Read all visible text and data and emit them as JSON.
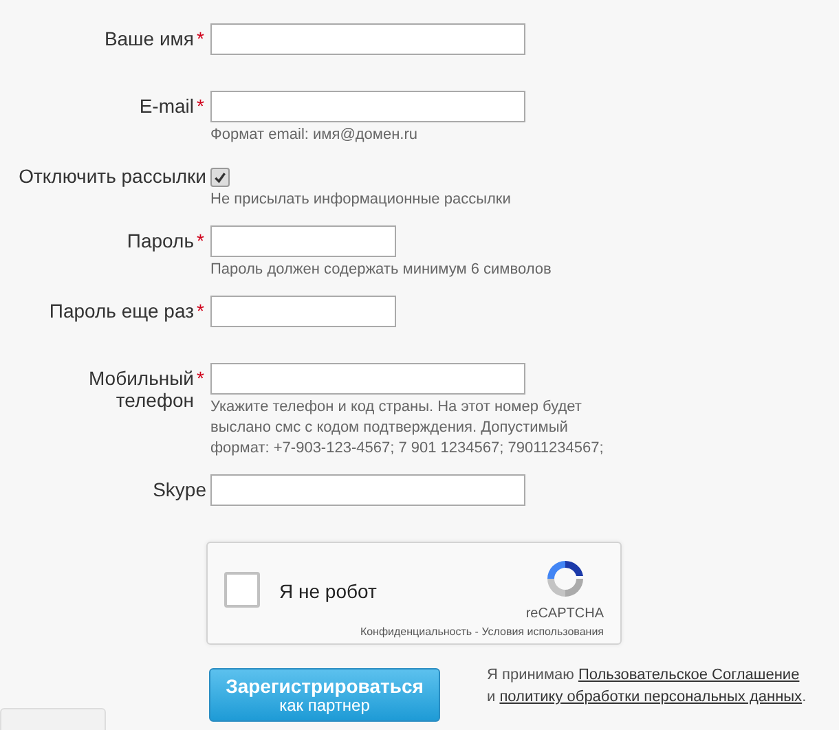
{
  "fields": [
    {
      "kind": "text",
      "label": "Ваше имя",
      "required_mark": "*"
    },
    {
      "kind": "text",
      "label": "E-mail",
      "required_mark": "*",
      "hint": "Формат email: имя@домен.ru"
    },
    {
      "kind": "checkbox",
      "label": "Отключить рассылки",
      "checked": true,
      "hint": "Не присылать информационные рассылки"
    },
    {
      "kind": "password",
      "label": "Пароль",
      "required_mark": "*",
      "hint": "Пароль должен содержать минимум 6 символов"
    },
    {
      "kind": "password",
      "label": "Пароль еще раз",
      "required_mark": "*"
    },
    {
      "kind": "text",
      "label": "Мобильный\nтелефон",
      "required_mark": "*",
      "hint": "Укажите телефон и код страны. На этот номер будет выслано смс с кодом подтверждения. Допустимый формат: +7-903-123-4567; 7 901 1234567; 79011234567;"
    },
    {
      "kind": "text",
      "label": "Skype"
    }
  ],
  "captcha": {
    "label": "Я не робот",
    "checked": false,
    "brand": "reCAPTCHA",
    "footer": "Конфиденциальность - Условия использования"
  },
  "submit": {
    "title": "Зарегистрироваться",
    "subtitle": "как партнер"
  },
  "agreement": {
    "prefix": "Я принимаю",
    "link_1": "Пользовательское Соглашение",
    "middle": "и",
    "link_2": "политику обработки персональных данных",
    "suffix": "."
  }
}
